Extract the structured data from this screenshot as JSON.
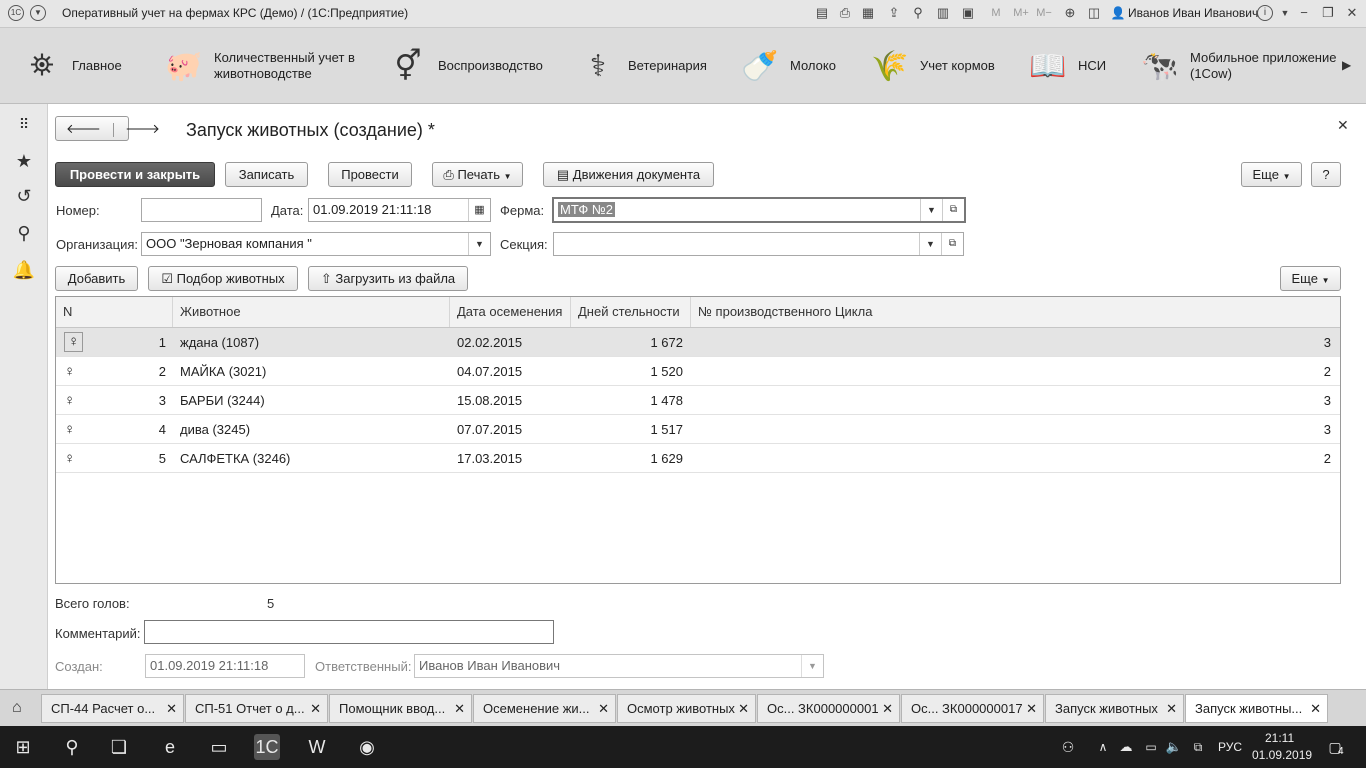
{
  "window": {
    "title": "Оперативный учет на фермах КРС (Демо) /  (1С:Предприятие)",
    "user": "Иванов Иван Иванович",
    "toolbar_m": "M",
    "toolbar_mplus": "M+",
    "toolbar_mminus": "M−"
  },
  "sections": [
    {
      "label": "Главное",
      "icon": "lamp-icon"
    },
    {
      "label": "Количественный учет в\nживотноводстве",
      "icon": "pig-icon"
    },
    {
      "label": "Воспроизводство",
      "icon": "gender-icon"
    },
    {
      "label": "Ветеринария",
      "icon": "medicine-icon"
    },
    {
      "label": "Молоко",
      "icon": "milk-bottle-icon"
    },
    {
      "label": "Учет кормов",
      "icon": "feed-bag-icon"
    },
    {
      "label": "НСИ",
      "icon": "book-icon"
    },
    {
      "label": "Мобильное приложение\n(1Cow)",
      "icon": "cow-icon"
    }
  ],
  "form": {
    "title": "Запуск животных (создание) *",
    "buttons": {
      "post_close": "Провести и закрыть",
      "save": "Записать",
      "post": "Провести",
      "print": "Печать",
      "movements": "Движения документа",
      "more": "Еще",
      "help": "?"
    },
    "number_label": "Номер:",
    "number_value": "",
    "date_label": "Дата:",
    "date_value": "01.09.2019 21:11:18",
    "farm_label": "Ферма:",
    "farm_value": "МТФ №2",
    "org_label": "Организация:",
    "org_value": "ООО \"Зерновая компания \"",
    "section_label": "Секция:",
    "section_value": "",
    "table_buttons": {
      "add": "Добавить",
      "pick": "Подбор животных",
      "load": "Загрузить из файла",
      "more": "Еще"
    },
    "columns": [
      "N",
      "Животное",
      "Дата осеменения",
      "Дней стельности",
      "№ производственного Цикла"
    ],
    "rows": [
      {
        "n": "1",
        "animal": "ждана (1087)",
        "date": "02.02.2015",
        "days": "1 672",
        "cycle": "3"
      },
      {
        "n": "2",
        "animal": "МАЙКА (3021)",
        "date": "04.07.2015",
        "days": "1 520",
        "cycle": "2"
      },
      {
        "n": "3",
        "animal": "БАРБИ (3244)",
        "date": "15.08.2015",
        "days": "1 478",
        "cycle": "3"
      },
      {
        "n": "4",
        "animal": "дива (3245)",
        "date": "07.07.2015",
        "days": "1 517",
        "cycle": "3"
      },
      {
        "n": "5",
        "animal": "САЛФЕТКА (3246)",
        "date": "17.03.2015",
        "days": "1 629",
        "cycle": "2"
      }
    ],
    "total_label": "Всего голов:",
    "total_value": "5",
    "comment_label": "Комментарий:",
    "comment_value": "",
    "created_label": "Создан:",
    "created_value": "01.09.2019 21:11:18",
    "responsible_label": "Ответственный:",
    "responsible_value": "Иванов Иван Иванович"
  },
  "tabs": [
    {
      "label": "СП-44 Расчет о..."
    },
    {
      "label": "СП-51 Отчет о д..."
    },
    {
      "label": "Помощник ввод..."
    },
    {
      "label": "Осеменение жи..."
    },
    {
      "label": "Осмотр животных"
    },
    {
      "label": "Ос... ЗК000000001"
    },
    {
      "label": "Ос... ЗК000000017"
    },
    {
      "label": "Запуск животных"
    },
    {
      "label": "Запуск животны..."
    }
  ],
  "taskbar": {
    "lang": "РУС",
    "time": "21:11",
    "date": "01.09.2019",
    "notif_count": "4"
  }
}
